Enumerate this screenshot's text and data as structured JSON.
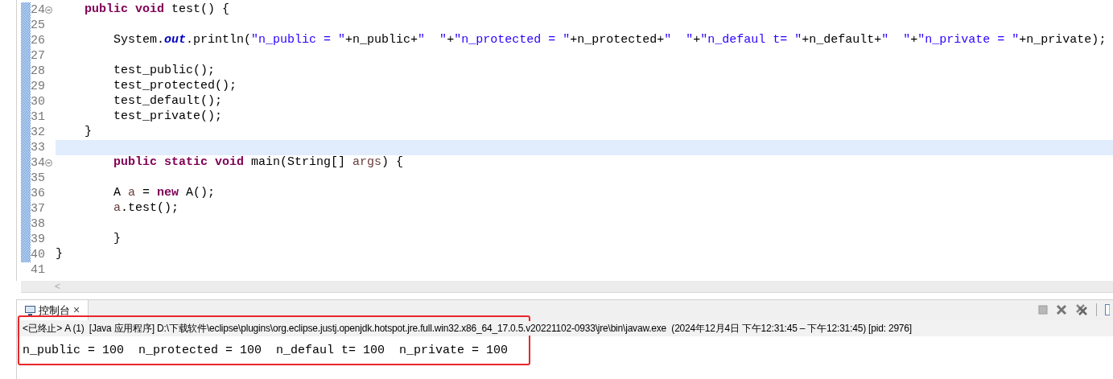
{
  "editor": {
    "lines": [
      {
        "number": "24",
        "fold": true,
        "current": false,
        "tokens": [
          {
            "kind": "keyword",
            "text": "    public void"
          },
          {
            "kind": "plain",
            "text": " test() {"
          }
        ]
      },
      {
        "number": "25",
        "fold": false,
        "current": false
      },
      {
        "number": "26",
        "fold": false,
        "current": false,
        "tokens": [
          {
            "kind": "plain",
            "text": "        System."
          },
          {
            "kind": "field",
            "text": "out"
          },
          {
            "kind": "plain",
            "text": ".println("
          },
          {
            "kind": "string",
            "text": "\"n_public = \""
          },
          {
            "kind": "plain",
            "text": "+n_public+"
          },
          {
            "kind": "string",
            "text": "\"  \""
          },
          {
            "kind": "plain",
            "text": "+"
          },
          {
            "kind": "string",
            "text": "\"n_protected = \""
          },
          {
            "kind": "plain",
            "text": "+n_protected+"
          },
          {
            "kind": "string",
            "text": "\"  \""
          },
          {
            "kind": "plain",
            "text": "+"
          },
          {
            "kind": "string",
            "text": "\"n_defaul t= \""
          },
          {
            "kind": "plain",
            "text": "+n_default+"
          },
          {
            "kind": "string",
            "text": "\"  \""
          },
          {
            "kind": "plain",
            "text": "+"
          },
          {
            "kind": "string",
            "text": "\"n_private = \""
          },
          {
            "kind": "plain",
            "text": "+n_private);"
          }
        ]
      },
      {
        "number": "27",
        "fold": false,
        "current": false
      },
      {
        "number": "28",
        "fold": false,
        "current": false,
        "tokens": [
          {
            "kind": "plain",
            "text": "        test_public();"
          }
        ]
      },
      {
        "number": "29",
        "fold": false,
        "current": false,
        "tokens": [
          {
            "kind": "plain",
            "text": "        test_protected();"
          }
        ]
      },
      {
        "number": "30",
        "fold": false,
        "current": false,
        "tokens": [
          {
            "kind": "plain",
            "text": "        test_default();"
          }
        ]
      },
      {
        "number": "31",
        "fold": false,
        "current": false,
        "tokens": [
          {
            "kind": "plain",
            "text": "        test_private();"
          }
        ]
      },
      {
        "number": "32",
        "fold": false,
        "current": false,
        "tokens": [
          {
            "kind": "plain",
            "text": "    }"
          }
        ]
      },
      {
        "number": "33",
        "fold": false,
        "current": true
      },
      {
        "number": "34",
        "fold": true,
        "current": false,
        "tokens": [
          {
            "kind": "keyword",
            "text": "        public static void"
          },
          {
            "kind": "plain",
            "text": " main(String[] "
          },
          {
            "kind": "local",
            "text": "args"
          },
          {
            "kind": "plain",
            "text": ") {"
          }
        ]
      },
      {
        "number": "35",
        "fold": false,
        "current": false
      },
      {
        "number": "36",
        "fold": false,
        "current": false,
        "tokens": [
          {
            "kind": "plain",
            "text": "        A "
          },
          {
            "kind": "local",
            "text": "a"
          },
          {
            "kind": "plain",
            "text": " = "
          },
          {
            "kind": "keyword",
            "text": "new"
          },
          {
            "kind": "plain",
            "text": " A();"
          }
        ]
      },
      {
        "number": "37",
        "fold": false,
        "current": false,
        "tokens": [
          {
            "kind": "local",
            "text": "        a"
          },
          {
            "kind": "plain",
            "text": ".test();"
          }
        ]
      },
      {
        "number": "38",
        "fold": false,
        "current": false
      },
      {
        "number": "39",
        "fold": false,
        "current": false,
        "tokens": [
          {
            "kind": "plain",
            "text": "        }"
          }
        ]
      },
      {
        "number": "40",
        "fold": false,
        "current": false,
        "tokens": [
          {
            "kind": "plain",
            "text": "}"
          }
        ]
      },
      {
        "number": "41",
        "fold": false,
        "current": false
      }
    ],
    "scroll_left": "<"
  },
  "console": {
    "tab": {
      "label": "控制台",
      "close": "×"
    },
    "header": "<已终止> A (1)  [Java 应用程序] D:\\下载软件\\eclipse\\plugins\\org.eclipse.justj.openjdk.hotspot.jre.full.win32.x86_64_17.0.5.v20221102-0933\\jre\\bin\\javaw.exe  (2024年12月4日 下午12:31:45 – 下午12:31:45) [pid: 2976]",
    "output": "n_public = 100  n_protected = 100  n_defaul t= 100  n_private = 100"
  }
}
